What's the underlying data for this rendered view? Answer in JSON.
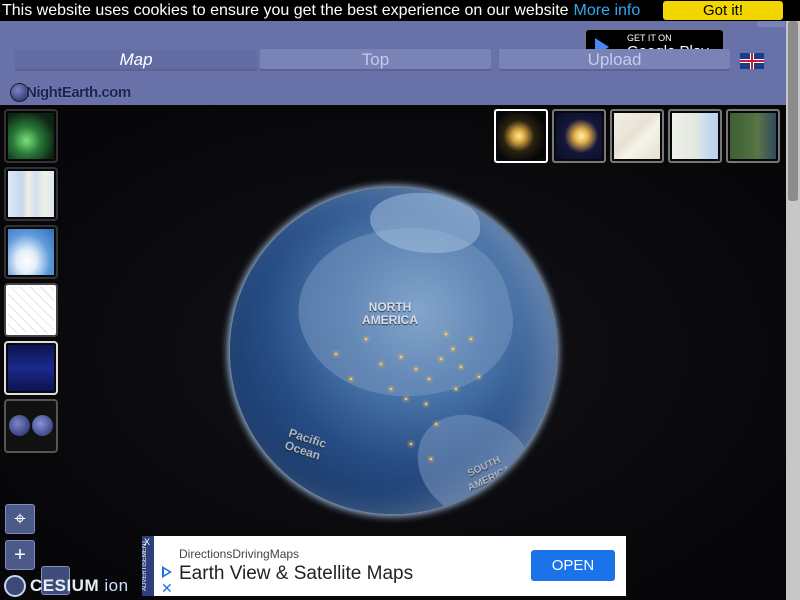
{
  "cookie": {
    "message": "This website uses cookies to ensure you get the best experience on our website",
    "more_info": "More info",
    "accept": "Got it!"
  },
  "header": {
    "play_badge_small": "GET IT ON",
    "play_badge_big": "Google Play",
    "tabs": [
      {
        "label": "Map",
        "active": true
      },
      {
        "label": "Top",
        "active": false
      },
      {
        "label": "Upload",
        "active": false
      }
    ],
    "logo": "NightEarth.com",
    "language_icon": "uk-flag-icon"
  },
  "globe": {
    "continent_1": "NORTH\nAMERICA",
    "ocean": "Pacific\nOcean",
    "continent_2": "SOUTH\nAMERICA"
  },
  "left_layers": [
    {
      "name": "aurora-layer",
      "icon": "aurora-icon"
    },
    {
      "name": "world-map-layer",
      "icon": "map-icon"
    },
    {
      "name": "clouds-layer",
      "icon": "clouds-icon"
    },
    {
      "name": "borders-layer",
      "icon": "borders-icon"
    },
    {
      "name": "night-world-layer",
      "icon": "night-map-icon"
    },
    {
      "name": "globes-layer",
      "icon": "globes-icon"
    }
  ],
  "right_layers": [
    "night-lights",
    "night-zoom",
    "street-map",
    "light-map",
    "satellite"
  ],
  "controls": {
    "locate": "⌖",
    "zoom_in": "+"
  },
  "cesium": {
    "brand": "CESIUM",
    "suffix": "ion"
  },
  "ad": {
    "side_label": "ADVERTISEMENT",
    "close": "X",
    "brand": "DirectionsDrivingMaps",
    "headline": "Earth View & Satellite Maps",
    "button": "OPEN"
  }
}
